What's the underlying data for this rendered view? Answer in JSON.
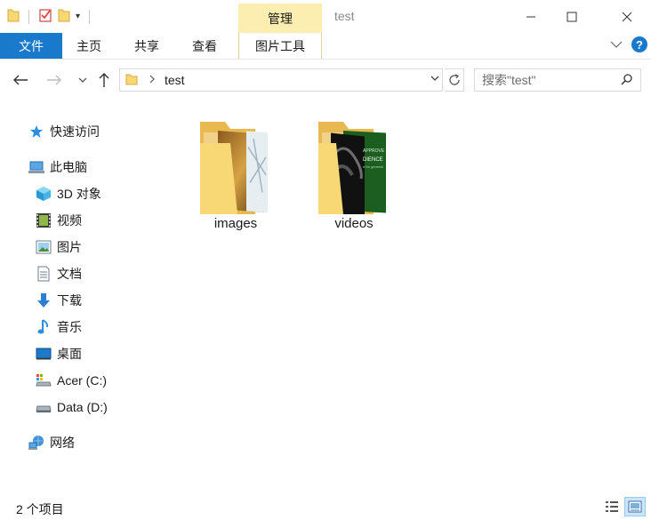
{
  "window": {
    "title": "test",
    "context_tab": "管理",
    "controls": [
      "minimize",
      "maximize",
      "close"
    ]
  },
  "ribbon": {
    "tabs": [
      "文件",
      "主页",
      "共享",
      "查看",
      "图片工具"
    ],
    "help_label": "?"
  },
  "address": {
    "path": [
      "test"
    ],
    "search_placeholder": "搜索\"test\""
  },
  "sidebar": {
    "quick_access": "快速访问",
    "this_pc": "此电脑",
    "items": [
      "3D 对象",
      "视频",
      "图片",
      "文档",
      "下载",
      "音乐",
      "桌面",
      "Acer (C:)",
      "Data (D:)"
    ],
    "network": "网络"
  },
  "content": {
    "folders": [
      {
        "name": "images"
      },
      {
        "name": "videos"
      }
    ],
    "video_thumb_text": [
      "APPROVE",
      "DIENCE",
      "d for general"
    ]
  },
  "status": {
    "item_count": "2 个项目"
  },
  "colors": {
    "accent_blue": "#1979ca",
    "manage_tab": "#fbeeb0",
    "folder_yellow": "#f8d775"
  }
}
